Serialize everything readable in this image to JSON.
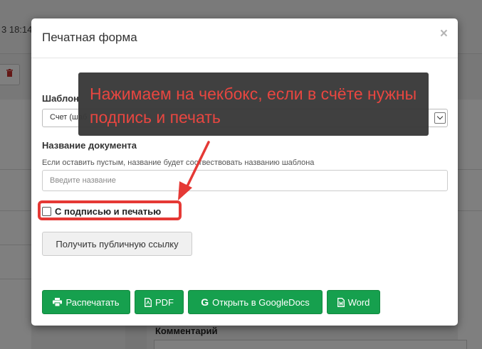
{
  "background": {
    "time_fragment": "3 18:14",
    "comment_label": "Комментарий"
  },
  "modal": {
    "title": "Печатная форма",
    "close_glyph": "×",
    "template": {
      "label": "Шаблон",
      "selected": "Счет (шаб"
    },
    "document_name": {
      "label": "Название документа",
      "hint": "Если оставить пустым, название будет соотвествовать названию шаблона",
      "placeholder": "Введите название",
      "value": ""
    },
    "signature_checkbox": {
      "label": "С подписью и печатью",
      "checked": false
    },
    "public_link_button": "Получить публичную ссылку",
    "actions": {
      "print": "Распечатать",
      "pdf": "PDF",
      "google_docs": "Открыть в GoogleDocs",
      "word": "Word"
    }
  },
  "annotation": {
    "text": "Нажимаем на чекбокс, если в счёте нужны подпись и печать",
    "color": "#e53935"
  },
  "colors": {
    "success": "#16a04e",
    "danger": "#c9302c"
  },
  "icons": [
    "trash-icon",
    "close-icon",
    "chevron-down-icon",
    "printer-icon",
    "pdf-file-icon",
    "google-icon",
    "word-file-icon",
    "arrow-icon"
  ]
}
